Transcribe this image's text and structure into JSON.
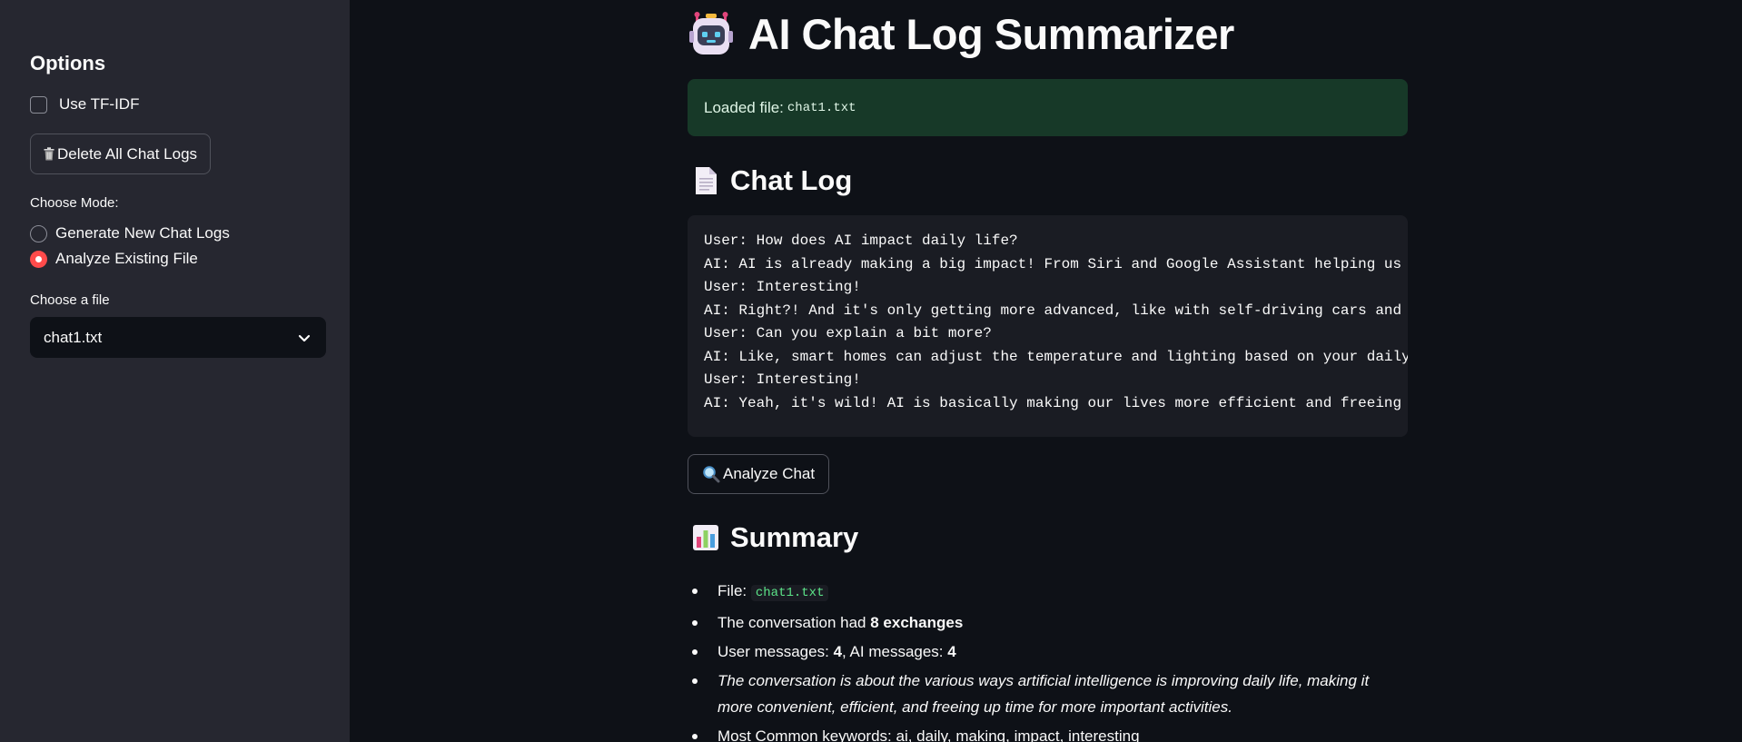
{
  "sidebar": {
    "heading": "Options",
    "tfidf_label": "Use TF-IDF",
    "delete_button": "Delete All Chat Logs",
    "mode_label": "Choose Mode:",
    "modes": [
      {
        "label": "Generate New Chat Logs",
        "selected": false
      },
      {
        "label": "Analyze Existing File",
        "selected": true
      }
    ],
    "file_label": "Choose a file",
    "file_selected": "chat1.txt"
  },
  "main": {
    "title": "AI Chat Log Summarizer",
    "alert_prefix": "Loaded file:",
    "alert_file": "chat1.txt",
    "chat_log_heading": "Chat Log",
    "chat_lines": [
      "User: How does AI impact daily life?",
      "AI: AI is already making a big impact! From Siri and Google Assistant helping us w",
      "User: Interesting!",
      "AI: Right?! And it's only getting more advanced, like with self-driving cars and s",
      "User: Can you explain a bit more?",
      "AI: Like, smart homes can adjust the temperature and lighting based on your daily",
      "User: Interesting!",
      "AI: Yeah, it's wild! AI is basically making our lives more efficient and freeing u"
    ],
    "analyze_button": "Analyze Chat",
    "summary_heading": "Summary",
    "summary": {
      "file_prefix": "File:",
      "file_name": "chat1.txt",
      "exchanges_prefix": "The conversation had",
      "exchanges_value": "8 exchanges",
      "user_prefix": "User messages:",
      "user_count": "4",
      "ai_prefix": ", AI messages:",
      "ai_count": "4",
      "topic": "The conversation is about the various ways artificial intelligence is improving daily life, making it more convenient, efficient, and freeing up time for more important activities.",
      "keywords": "Most Common keywords: ai, daily, making, impact, interesting"
    }
  },
  "colors": {
    "background": "#0e1117",
    "sidebar": "#262730",
    "accent_radio": "#ff4b4b",
    "success_bg": "#173928",
    "code_text": "#5ce488"
  }
}
